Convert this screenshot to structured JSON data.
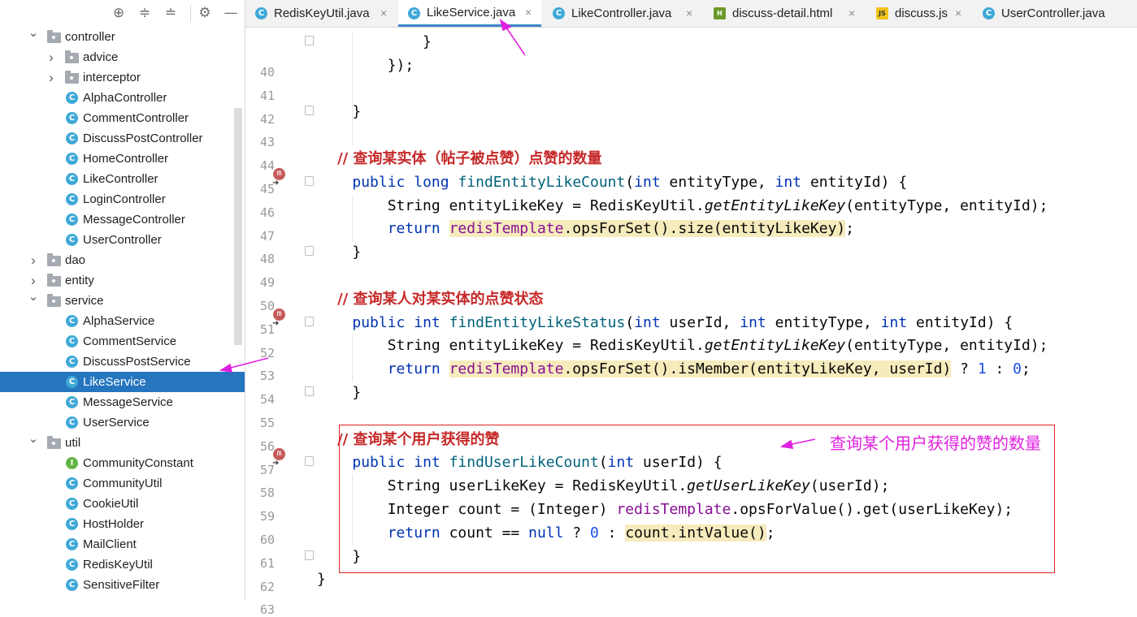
{
  "toolbar": {
    "icons": [
      "locate-icon",
      "expand-all-icon",
      "collapse-all-icon",
      "settings-icon",
      "hide-icon"
    ]
  },
  "tree": {
    "items": [
      {
        "label": "controller",
        "type": "folder",
        "depth": 0,
        "expanded": true
      },
      {
        "label": "advice",
        "type": "folder",
        "depth": 1,
        "expanded": false
      },
      {
        "label": "interceptor",
        "type": "folder",
        "depth": 1,
        "expanded": false
      },
      {
        "label": "AlphaController",
        "type": "class",
        "depth": 1
      },
      {
        "label": "CommentController",
        "type": "class",
        "depth": 1
      },
      {
        "label": "DiscussPostController",
        "type": "class",
        "depth": 1
      },
      {
        "label": "HomeController",
        "type": "class",
        "depth": 1
      },
      {
        "label": "LikeController",
        "type": "class",
        "depth": 1
      },
      {
        "label": "LoginController",
        "type": "class",
        "depth": 1
      },
      {
        "label": "MessageController",
        "type": "class",
        "depth": 1
      },
      {
        "label": "UserController",
        "type": "class",
        "depth": 1
      },
      {
        "label": "dao",
        "type": "folder",
        "depth": 0,
        "expanded": false
      },
      {
        "label": "entity",
        "type": "folder",
        "depth": 0,
        "expanded": false
      },
      {
        "label": "service",
        "type": "folder",
        "depth": 0,
        "expanded": true
      },
      {
        "label": "AlphaService",
        "type": "class",
        "depth": 1
      },
      {
        "label": "CommentService",
        "type": "class",
        "depth": 1
      },
      {
        "label": "DiscussPostService",
        "type": "class",
        "depth": 1
      },
      {
        "label": "LikeService",
        "type": "class",
        "depth": 1,
        "selected": true
      },
      {
        "label": "MessageService",
        "type": "class",
        "depth": 1
      },
      {
        "label": "UserService",
        "type": "class",
        "depth": 1
      },
      {
        "label": "util",
        "type": "folder",
        "depth": 0,
        "expanded": true
      },
      {
        "label": "CommunityConstant",
        "type": "interface",
        "depth": 1
      },
      {
        "label": "CommunityUtil",
        "type": "class",
        "depth": 1
      },
      {
        "label": "CookieUtil",
        "type": "class",
        "depth": 1
      },
      {
        "label": "HostHolder",
        "type": "class",
        "depth": 1
      },
      {
        "label": "MailClient",
        "type": "class",
        "depth": 1
      },
      {
        "label": "RedisKeyUtil",
        "type": "class",
        "depth": 1
      },
      {
        "label": "SensitiveFilter",
        "type": "class",
        "depth": 1
      }
    ]
  },
  "tabs": [
    {
      "label": "RedisKeyUtil.java",
      "icon": "C",
      "active": false
    },
    {
      "label": "LikeService.java",
      "icon": "C",
      "active": true
    },
    {
      "label": "LikeController.java",
      "icon": "C",
      "active": false
    },
    {
      "label": "discuss-detail.html",
      "icon": "H",
      "active": false
    },
    {
      "label": "discuss.js",
      "icon": "JS",
      "active": false
    },
    {
      "label": "UserController.java",
      "icon": "C",
      "active": false
    }
  ],
  "editor": {
    "lines": [
      {
        "no": "40",
        "text": "            }"
      },
      {
        "no": "41",
        "text": "        });"
      },
      {
        "no": "42",
        "text": ""
      },
      {
        "no": "43",
        "text": "    }"
      },
      {
        "no": "44",
        "text": ""
      },
      {
        "no": "45",
        "text": "    // 查询某实体（帖子被点赞）点赞的数量"
      },
      {
        "no": "46",
        "text": "    public long findEntityLikeCount(int entityType, int entityId) {"
      },
      {
        "no": "47",
        "text": "        String entityLikeKey = RedisKeyUtil.getEntityLikeKey(entityType, entityId);"
      },
      {
        "no": "48",
        "text": "        return redisTemplate.opsForSet().size(entityLikeKey);"
      },
      {
        "no": "49",
        "text": "    }"
      },
      {
        "no": "50",
        "text": ""
      },
      {
        "no": "51",
        "text": "    // 查询某人对某实体的点赞状态"
      },
      {
        "no": "52",
        "text": "    public int findEntityLikeStatus(int userId, int entityType, int entityId) {"
      },
      {
        "no": "53",
        "text": "        String entityLikeKey = RedisKeyUtil.getEntityLikeKey(entityType, entityId);"
      },
      {
        "no": "54",
        "text": "        return redisTemplate.opsForSet().isMember(entityLikeKey, userId) ? 1 : 0;"
      },
      {
        "no": "55",
        "text": "    }"
      },
      {
        "no": "56",
        "text": ""
      },
      {
        "no": "57",
        "text": "    // 查询某个用户获得的赞"
      },
      {
        "no": "58",
        "text": "    public int findUserLikeCount(int userId) {"
      },
      {
        "no": "59",
        "text": "        String userLikeKey = RedisKeyUtil.getUserLikeKey(userId);"
      },
      {
        "no": "60",
        "text": "        Integer count = (Integer) redisTemplate.opsForValue().get(userLikeKey);"
      },
      {
        "no": "61",
        "text": "        return count == null ? 0 : count.intValue();"
      },
      {
        "no": "62",
        "text": "    }"
      },
      {
        "no": "63",
        "text": "}"
      }
    ],
    "method_marker": "m"
  },
  "annotation": {
    "note": "查询某个用户获得的赞的数量",
    "color": "#e020e0",
    "box_color": "#e02424"
  },
  "colors": {
    "selection": "#2675bf",
    "keyword": "#0033b3",
    "comment": "#c62828",
    "field": "#871094"
  }
}
